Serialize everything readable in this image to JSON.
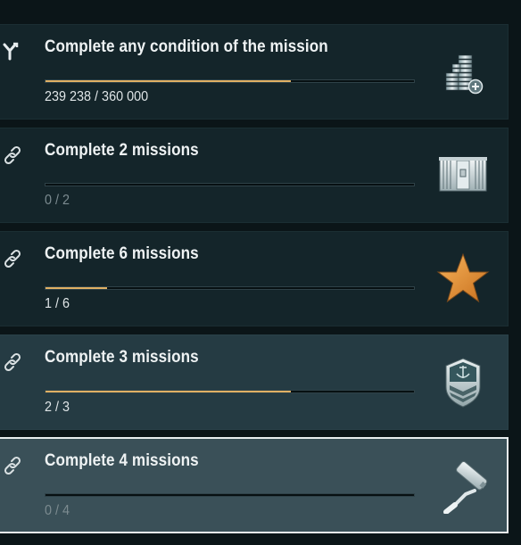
{
  "missions": [
    {
      "title": "Complete any condition of the mission",
      "progress_text": "239 238 / 360 000",
      "progress": 0.665,
      "lead_icon": "branch-icon",
      "reward_icon": "credits-stack-icon"
    },
    {
      "title": "Complete 2 missions",
      "progress_text": "0 / 2",
      "progress": 0,
      "lead_icon": "chain-link-icon",
      "reward_icon": "container-icon"
    },
    {
      "title": "Complete 6 missions",
      "progress_text": "1 / 6",
      "progress": 0.1667,
      "lead_icon": "chain-link-icon",
      "reward_icon": "star-icon"
    },
    {
      "title": "Complete 3 missions",
      "progress_text": "2 / 3",
      "progress": 0.6667,
      "lead_icon": "chain-link-icon",
      "reward_icon": "commander-anchor-badge-icon"
    },
    {
      "title": "Complete 4 missions",
      "progress_text": "0 / 4",
      "progress": 0,
      "lead_icon": "chain-link-icon",
      "reward_icon": "paint-roller-icon"
    }
  ],
  "colors": {
    "progress_fill": "#e0b064",
    "star": "#e8963a",
    "selected_border": "#e9eef0"
  }
}
